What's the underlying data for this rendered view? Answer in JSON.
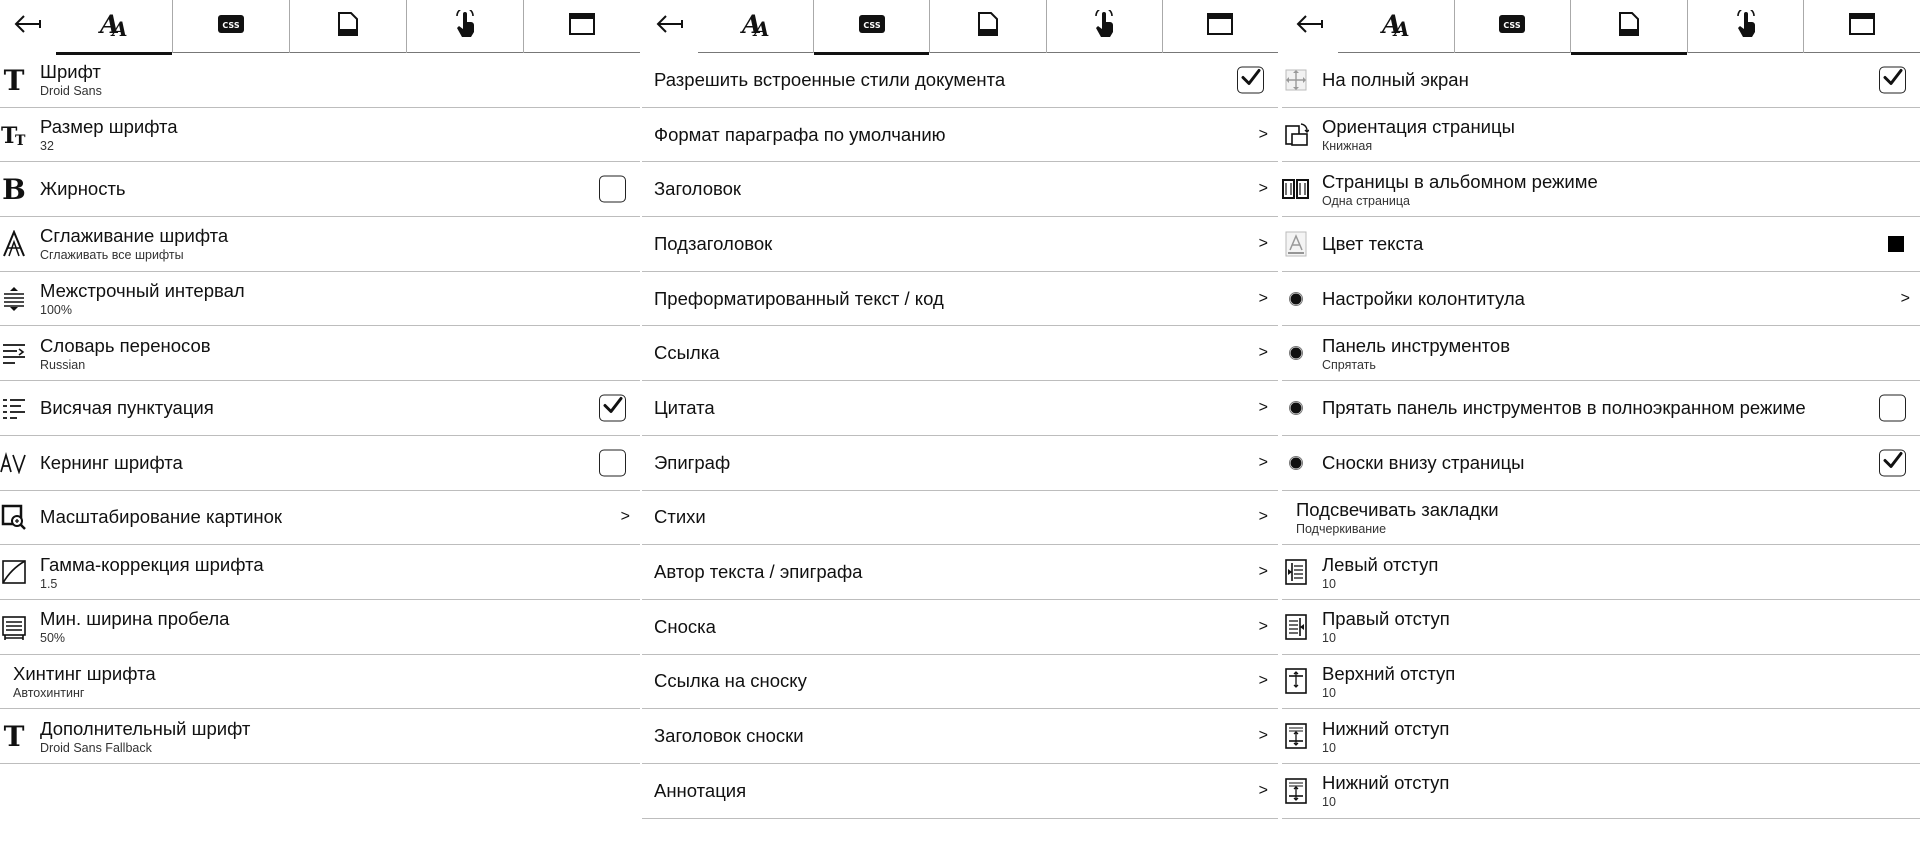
{
  "panels": [
    {
      "id": "font",
      "tabs": [
        {
          "icon": "font-tab-icon",
          "active": true
        },
        {
          "icon": "css-tab-icon",
          "active": false
        },
        {
          "icon": "page-tab-icon",
          "active": false
        },
        {
          "icon": "touch-tab-icon",
          "active": false
        },
        {
          "icon": "window-tab-icon",
          "active": false
        }
      ],
      "tab_css_label": "CSS",
      "items": [
        {
          "title": "Шрифт",
          "sub": "Droid Sans",
          "icon": "font-icon",
          "control": "none"
        },
        {
          "title": "Размер шрифта",
          "sub": "32",
          "icon": "font-size-icon",
          "control": "none"
        },
        {
          "title": "Жирность",
          "sub": "",
          "icon": "bold-icon",
          "control": "checkbox",
          "checked": false
        },
        {
          "title": "Сглаживание шрифта",
          "sub": "Сглаживать все шрифты",
          "icon": "antialias-icon",
          "control": "none"
        },
        {
          "title": "Межстрочный интервал",
          "sub": "100%",
          "icon": "line-spacing-icon",
          "control": "none"
        },
        {
          "title": "Словарь переносов",
          "sub": "Russian",
          "icon": "hyphenation-icon",
          "control": "none"
        },
        {
          "title": "Висячая пунктуация",
          "sub": "",
          "icon": "hanging-punctuation-icon",
          "control": "checkbox",
          "checked": true
        },
        {
          "title": "Кернинг шрифта",
          "sub": "",
          "icon": "kerning-icon",
          "control": "checkbox",
          "checked": false
        },
        {
          "title": "Масштабирование картинок",
          "sub": "",
          "icon": "image-scale-icon",
          "control": "chevron"
        },
        {
          "title": "Гамма-коррекция шрифта",
          "sub": "1.5",
          "icon": "gamma-icon",
          "control": "none"
        },
        {
          "title": "Мин. ширина пробела",
          "sub": "50%",
          "icon": "space-width-icon",
          "control": "none"
        },
        {
          "title": "Хинтинг шрифта",
          "sub": "Автохинтинг",
          "icon": "",
          "control": "none"
        },
        {
          "title": "Дополнительный шрифт",
          "sub": "Droid Sans Fallback",
          "icon": "font-icon",
          "control": "none"
        }
      ]
    },
    {
      "id": "css",
      "tabs": [
        {
          "icon": "font-tab-icon",
          "active": false
        },
        {
          "icon": "css-tab-icon",
          "active": true
        },
        {
          "icon": "page-tab-icon",
          "active": false
        },
        {
          "icon": "touch-tab-icon",
          "active": false
        },
        {
          "icon": "window-tab-icon",
          "active": false
        }
      ],
      "tab_css_label": "CSS",
      "items": [
        {
          "title": "Разрешить встроенные стили документа",
          "sub": "",
          "icon": "",
          "control": "checkbox",
          "checked": true
        },
        {
          "title": "Формат параграфа по умолчанию",
          "sub": "",
          "icon": "",
          "control": "chevron"
        },
        {
          "title": "Заголовок",
          "sub": "",
          "icon": "",
          "control": "chevron"
        },
        {
          "title": "Подзаголовок",
          "sub": "",
          "icon": "",
          "control": "chevron"
        },
        {
          "title": "Преформатированный текст / код",
          "sub": "",
          "icon": "",
          "control": "chevron"
        },
        {
          "title": "Ссылка",
          "sub": "",
          "icon": "",
          "control": "chevron"
        },
        {
          "title": "Цитата",
          "sub": "",
          "icon": "",
          "control": "chevron"
        },
        {
          "title": "Эпиграф",
          "sub": "",
          "icon": "",
          "control": "chevron"
        },
        {
          "title": "Стихи",
          "sub": "",
          "icon": "",
          "control": "chevron"
        },
        {
          "title": "Автор текста / эпиграфа",
          "sub": "",
          "icon": "",
          "control": "chevron"
        },
        {
          "title": "Сноска",
          "sub": "",
          "icon": "",
          "control": "chevron"
        },
        {
          "title": "Ссылка на сноску",
          "sub": "",
          "icon": "",
          "control": "chevron"
        },
        {
          "title": "Заголовок сноски",
          "sub": "",
          "icon": "",
          "control": "chevron"
        },
        {
          "title": "Аннотация",
          "sub": "",
          "icon": "",
          "control": "chevron"
        }
      ]
    },
    {
      "id": "page",
      "tabs": [
        {
          "icon": "font-tab-icon",
          "active": false
        },
        {
          "icon": "css-tab-icon",
          "active": false
        },
        {
          "icon": "page-tab-icon",
          "active": true
        },
        {
          "icon": "touch-tab-icon",
          "active": false
        },
        {
          "icon": "window-tab-icon",
          "active": false
        }
      ],
      "tab_css_label": "CSS",
      "items": [
        {
          "title": "На полный экран",
          "sub": "",
          "icon": "fullscreen-icon",
          "control": "checkbox",
          "checked": true
        },
        {
          "title": "Ориентация страницы",
          "sub": "Книжная",
          "icon": "orientation-icon",
          "control": "none"
        },
        {
          "title": "Страницы в альбомном режиме",
          "sub": "Одна страница",
          "icon": "landscape-pages-icon",
          "control": "none"
        },
        {
          "title": "Цвет текста",
          "sub": "",
          "icon": "text-color-icon",
          "control": "swatch"
        },
        {
          "title": "Настройки колонтитула",
          "sub": "",
          "icon": "bullet-icon",
          "control": "chevron"
        },
        {
          "title": "Панель инструментов",
          "sub": "Спрятать",
          "icon": "bullet-icon",
          "control": "none"
        },
        {
          "title": "Прятать панель инструментов в полноэкранном режиме",
          "sub": "",
          "icon": "bullet-icon",
          "control": "checkbox",
          "checked": false
        },
        {
          "title": "Сноски внизу страницы",
          "sub": "",
          "icon": "bullet-icon",
          "control": "checkbox",
          "checked": true
        },
        {
          "title": "Подсвечивать закладки",
          "sub": "Подчеркивание",
          "icon": "",
          "control": "none"
        },
        {
          "title": "Левый отступ",
          "sub": "10",
          "icon": "margin-left-icon",
          "control": "none"
        },
        {
          "title": "Правый отступ",
          "sub": "10",
          "icon": "margin-right-icon",
          "control": "none"
        },
        {
          "title": "Верхний отступ",
          "sub": "10",
          "icon": "margin-top-icon",
          "control": "none"
        },
        {
          "title": "Нижний отступ",
          "sub": "10",
          "icon": "margin-bottom-icon",
          "control": "none"
        },
        {
          "title": "Нижний отступ",
          "sub": "10",
          "icon": "margin-bottom-icon",
          "control": "none"
        }
      ]
    }
  ],
  "colors": {
    "text": "#111111",
    "divider": "#bdbdbd",
    "swatch": "#000000"
  }
}
